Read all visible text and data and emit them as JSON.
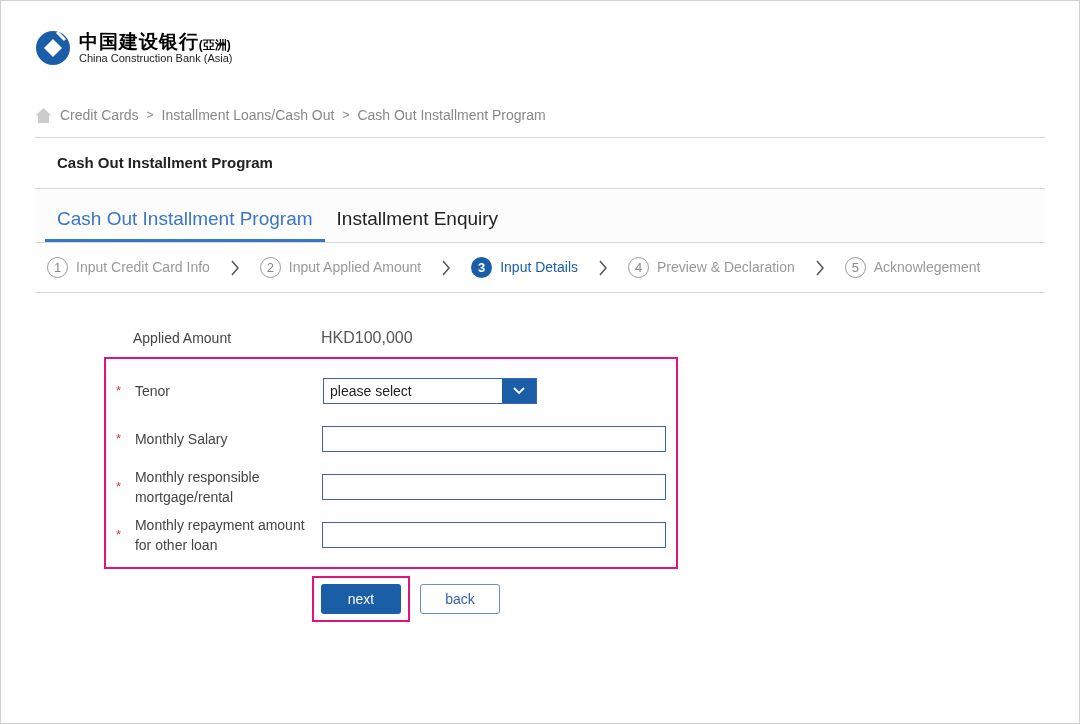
{
  "logo": {
    "chinese": "中国建设银行",
    "region": "(亞洲)",
    "english": "China Construction Bank (Asia)"
  },
  "breadcrumb": [
    "Credit Cards",
    "Installment Loans/Cash Out",
    "Cash Out Installment Program"
  ],
  "breadcrumb_separator": ">",
  "page_title": "Cash Out Installment Program",
  "tabs": [
    {
      "label": "Cash Out Installment Program",
      "selected": true
    },
    {
      "label": "Installment Enquiry",
      "selected": false
    }
  ],
  "steps": [
    {
      "number": "1",
      "label": "Input Credit Card Info",
      "selected": false
    },
    {
      "number": "2",
      "label": "Input Applied Amount",
      "selected": false
    },
    {
      "number": "3",
      "label": "Input Details",
      "selected": true
    },
    {
      "number": "4",
      "label": "Preview & Declaration",
      "selected": false
    },
    {
      "number": "5",
      "label": "Acknowlegement",
      "selected": false
    }
  ],
  "applied_amount": {
    "label": "Applied Amount",
    "value": "HKD100,000"
  },
  "fields": [
    {
      "kind": "select",
      "marker": "*",
      "label": "Tenor",
      "value": "please select"
    },
    {
      "kind": "text",
      "marker": "*",
      "label": "Monthly Salary"
    },
    {
      "kind": "text",
      "marker": "*",
      "label": "Monthly responsible mortgage/rental"
    },
    {
      "kind": "text",
      "marker": "*",
      "label": "Monthly repayment amount for other loan"
    }
  ],
  "buttons": [
    {
      "label": "next",
      "kind": "primary",
      "highlighted": true
    },
    {
      "label": "back",
      "kind": "secondary",
      "highlighted": false
    }
  ]
}
